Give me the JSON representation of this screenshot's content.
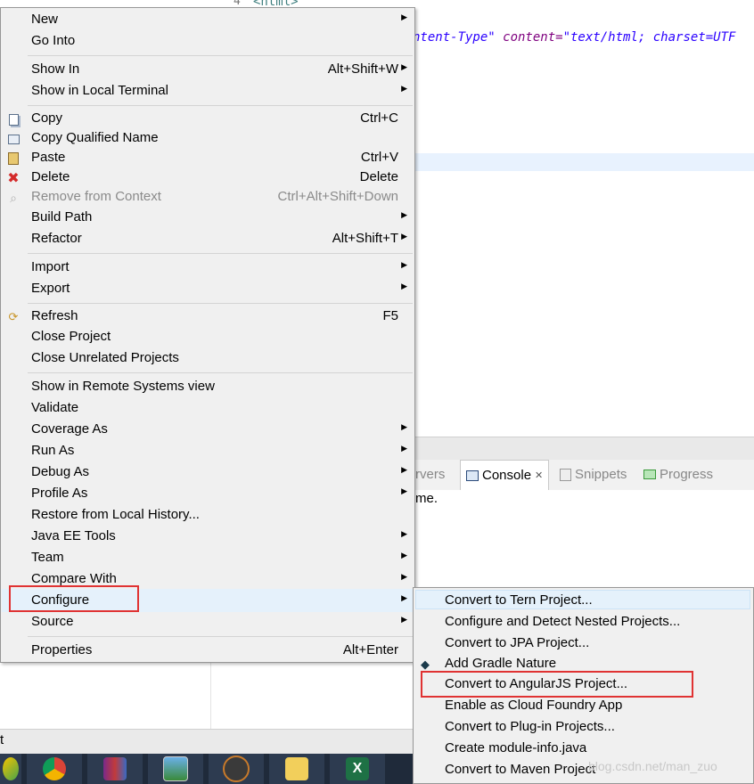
{
  "editor": {
    "line_number": "4",
    "code_fragment_tag": "<html>",
    "code_attr1": "ntent-Type\"",
    "code_attr2": " content=",
    "code_val": "\"text/html; charset=UTF"
  },
  "views": {
    "tabs": [
      {
        "label": "rvers",
        "active": false
      },
      {
        "label": "Console",
        "active": true
      },
      {
        "label": "Snippets",
        "active": false
      },
      {
        "label": "Progress",
        "active": false
      }
    ],
    "console_text": "me."
  },
  "status_text": "t",
  "watermark": "blog.csdn.net/man_zuo",
  "menu": {
    "items": [
      {
        "label": "New",
        "shortcut": "",
        "submenu": true,
        "icon": ""
      },
      {
        "label": "Go Into",
        "shortcut": "",
        "submenu": false,
        "icon": ""
      },
      {
        "label": "Show In",
        "shortcut": "Alt+Shift+W",
        "submenu": true,
        "icon": ""
      },
      {
        "label": "Show in Local Terminal",
        "shortcut": "",
        "submenu": true,
        "icon": ""
      },
      {
        "label": "Copy",
        "shortcut": "Ctrl+C",
        "submenu": false,
        "icon": "copy-icon"
      },
      {
        "label": "Copy Qualified Name",
        "shortcut": "",
        "submenu": false,
        "icon": "copy-qualified-name-icon"
      },
      {
        "label": "Paste",
        "shortcut": "Ctrl+V",
        "submenu": false,
        "icon": "paste-icon"
      },
      {
        "label": "Delete",
        "shortcut": "Delete",
        "submenu": false,
        "icon": "delete-icon"
      },
      {
        "label": "Remove from Context",
        "shortcut": "Ctrl+Alt+Shift+Down",
        "submenu": false,
        "icon": "remove-context-icon",
        "disabled": true
      },
      {
        "label": "Build Path",
        "shortcut": "",
        "submenu": true,
        "icon": ""
      },
      {
        "label": "Refactor",
        "shortcut": "Alt+Shift+T",
        "submenu": true,
        "icon": ""
      },
      {
        "label": "Import",
        "shortcut": "",
        "submenu": true,
        "icon": ""
      },
      {
        "label": "Export",
        "shortcut": "",
        "submenu": true,
        "icon": ""
      },
      {
        "label": "Refresh",
        "shortcut": "F5",
        "submenu": false,
        "icon": "refresh-icon"
      },
      {
        "label": "Close Project",
        "shortcut": "",
        "submenu": false,
        "icon": ""
      },
      {
        "label": "Close Unrelated Projects",
        "shortcut": "",
        "submenu": false,
        "icon": ""
      },
      {
        "label": "Show in Remote Systems view",
        "shortcut": "",
        "submenu": false,
        "icon": ""
      },
      {
        "label": "Validate",
        "shortcut": "",
        "submenu": false,
        "icon": ""
      },
      {
        "label": "Coverage As",
        "shortcut": "",
        "submenu": true,
        "icon": ""
      },
      {
        "label": "Run As",
        "shortcut": "",
        "submenu": true,
        "icon": ""
      },
      {
        "label": "Debug As",
        "shortcut": "",
        "submenu": true,
        "icon": ""
      },
      {
        "label": "Profile As",
        "shortcut": "",
        "submenu": true,
        "icon": ""
      },
      {
        "label": "Restore from Local History...",
        "shortcut": "",
        "submenu": false,
        "icon": ""
      },
      {
        "label": "Java EE Tools",
        "shortcut": "",
        "submenu": true,
        "icon": ""
      },
      {
        "label": "Team",
        "shortcut": "",
        "submenu": true,
        "icon": ""
      },
      {
        "label": "Compare With",
        "shortcut": "",
        "submenu": true,
        "icon": ""
      },
      {
        "label": "Configure",
        "shortcut": "",
        "submenu": true,
        "icon": "",
        "highlighted": true
      },
      {
        "label": "Source",
        "shortcut": "",
        "submenu": true,
        "icon": ""
      },
      {
        "label": "Properties",
        "shortcut": "Alt+Enter",
        "submenu": false,
        "icon": ""
      }
    ]
  },
  "submenu": {
    "items": [
      {
        "label": "Convert to Tern Project...",
        "icon": ""
      },
      {
        "label": "Configure and Detect Nested Projects...",
        "icon": ""
      },
      {
        "label": "Convert to JPA Project...",
        "icon": ""
      },
      {
        "label": "Add Gradle Nature",
        "icon": "gradle-icon"
      },
      {
        "label": "Convert to AngularJS Project...",
        "icon": "",
        "annotated": true
      },
      {
        "label": "Enable as Cloud Foundry App",
        "icon": ""
      },
      {
        "label": "Convert to Plug-in Projects...",
        "icon": ""
      },
      {
        "label": "Create module-info.java",
        "icon": ""
      },
      {
        "label": "Convert to Maven Project",
        "icon": ""
      }
    ]
  },
  "colors": {
    "annotation_red": "#e03333",
    "menu_bg": "#f0f0f0",
    "highlight": "#e5f1fb"
  }
}
